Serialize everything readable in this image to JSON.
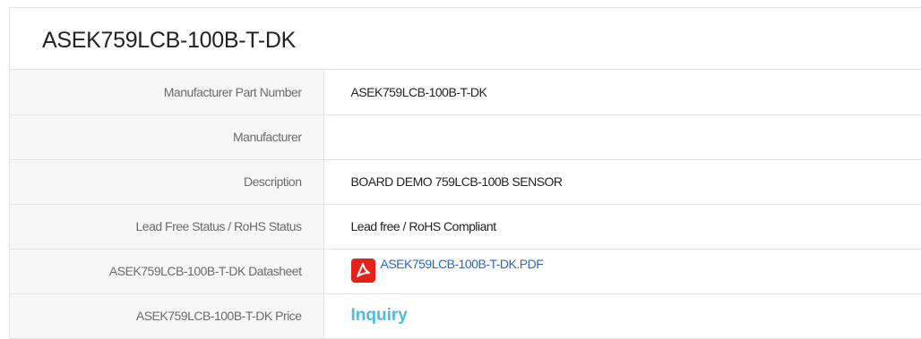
{
  "title": "ASEK759LCB-100B-T-DK",
  "rows": [
    {
      "label": "Manufacturer Part Number",
      "value": "ASEK759LCB-100B-T-DK"
    },
    {
      "label": "Manufacturer",
      "value": ""
    },
    {
      "label": "Description",
      "value": "BOARD DEMO 759LCB-100B SENSOR"
    },
    {
      "label": "Lead Free Status / RoHS Status",
      "value": "Lead free / RoHS Compliant"
    },
    {
      "label": "ASEK759LCB-100B-T-DK Datasheet",
      "value": "ASEK759LCB-100B-T-DK.PDF",
      "icon": "pdf-icon"
    },
    {
      "label": "ASEK759LCB-100B-T-DK Price",
      "value": "Inquiry"
    }
  ],
  "colors": {
    "link": "#2766c4",
    "inquiry": "#4eb8e6",
    "pdf_icon": "#e3231b",
    "label_bg": "#f7f7f7",
    "border": "#e3e3e3"
  }
}
